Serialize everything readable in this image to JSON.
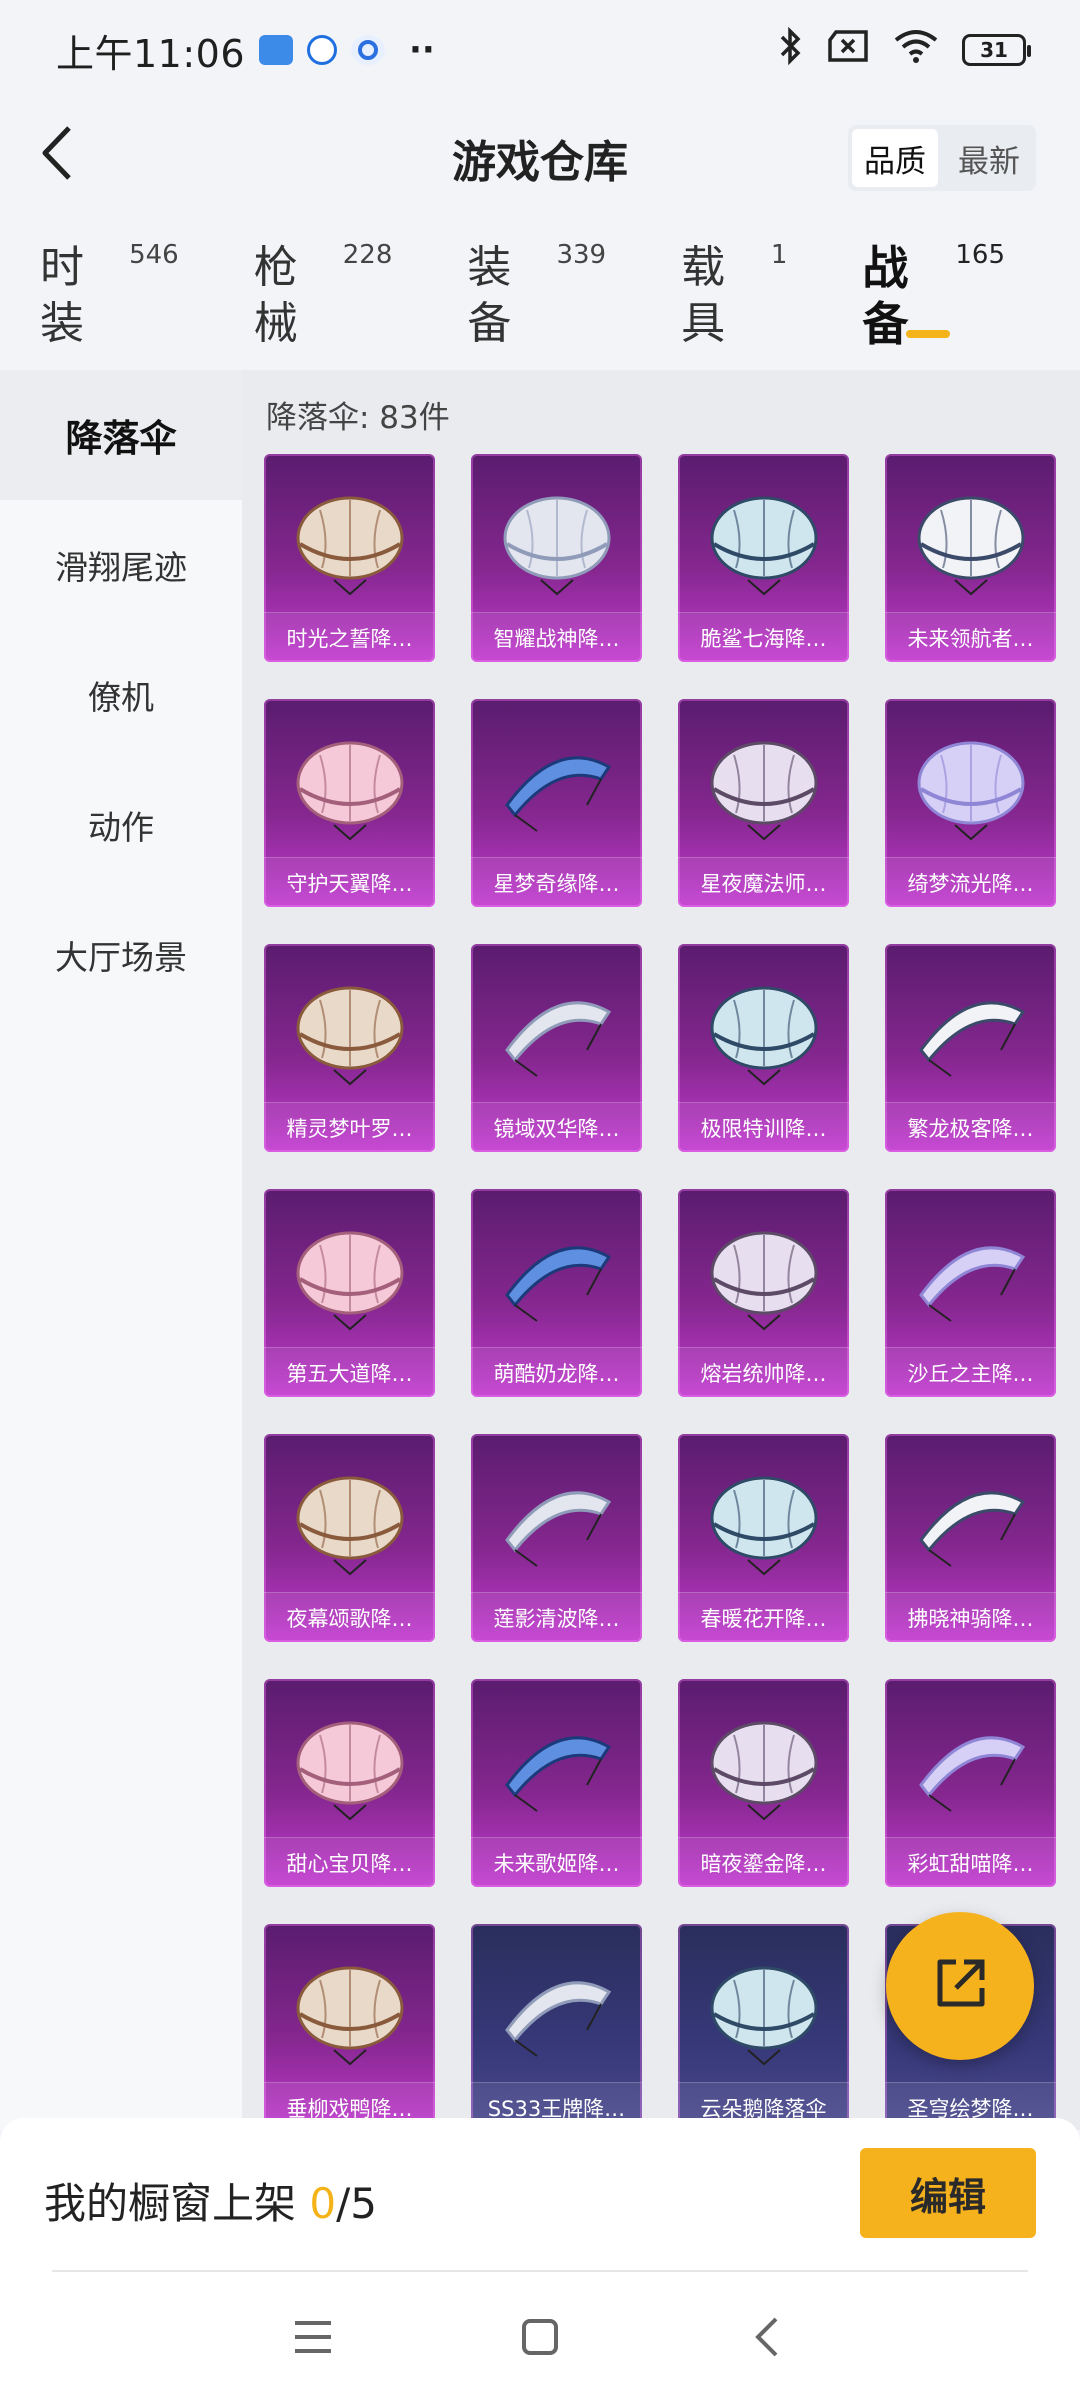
{
  "status_bar": {
    "time": "上午11:06",
    "battery": "31",
    "app_icons": [
      "message-app-icon",
      "map-app-icon",
      "browser-app-icon"
    ],
    "right_icons": [
      "bluetooth-icon",
      "no-sim-icon",
      "wifi-icon",
      "battery-icon"
    ]
  },
  "header": {
    "title": "游戏仓库",
    "sort": {
      "quality": "品质",
      "latest": "最新",
      "selected": "品质"
    }
  },
  "tabs": [
    {
      "label": "时装",
      "count": "546"
    },
    {
      "label": "枪械",
      "count": "228"
    },
    {
      "label": "装备",
      "count": "339"
    },
    {
      "label": "载具",
      "count": "1"
    },
    {
      "label": "战备",
      "count": "165",
      "active": true
    }
  ],
  "sidebar": {
    "items": [
      "降落伞",
      "滑翔尾迹",
      "僚机",
      "动作",
      "大厅场景"
    ],
    "active": "降落伞"
  },
  "content": {
    "count_label": "降落伞: 83件",
    "items": [
      "时光之誓降…",
      "智耀战神降…",
      "脆鲨七海降…",
      "未来领航者…",
      "守护天翼降…",
      "星梦奇缘降…",
      "星夜魔法师…",
      "绮梦流光降…",
      "精灵梦叶罗…",
      "镜域双华降…",
      "极限特训降…",
      "繁龙极客降…",
      "第五大道降…",
      "萌酷奶龙降…",
      "熔岩统帅降…",
      "沙丘之主降…",
      "夜幕颂歌降…",
      "莲影清波降…",
      "春暖花开降…",
      "拂晓神骑降…",
      "甜心宝贝降…",
      "未来歌姬降…",
      "暗夜鎏金降…",
      "彩虹甜喵降…",
      "垂柳戏鸭降…",
      "SS33王牌降…",
      "云朵鹅降落伞",
      "圣穹绘梦降…"
    ]
  },
  "bottom": {
    "showcase_label": "我的橱窗上架",
    "showcase_current": "0",
    "showcase_total": "/5",
    "edit_label": "编辑"
  },
  "colors": {
    "accent": "#f6b21d",
    "card_purple": "#85278f",
    "card_blue": "#37397a"
  }
}
